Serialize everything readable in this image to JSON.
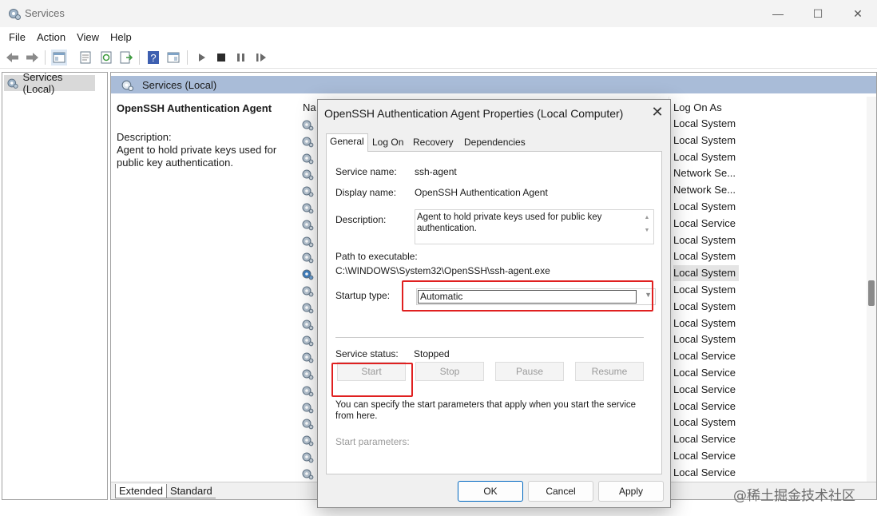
{
  "window": {
    "title": "Services",
    "minimize_glyph": "—",
    "maximize_glyph": "☐",
    "close_glyph": "✕"
  },
  "menu": [
    "File",
    "Action",
    "View",
    "Help"
  ],
  "toolbar_icons": [
    "back-arrow-icon",
    "forward-arrow-icon",
    "show-console-tree-icon",
    "properties-icon",
    "refresh-icon",
    "export-list-icon",
    "help-icon",
    "show-action-pane-icon",
    "start-service-icon",
    "stop-service-icon",
    "pause-service-icon",
    "resume-service-icon"
  ],
  "tree": {
    "selected_label": "Services (Local)"
  },
  "main": {
    "header": "Services (Local)",
    "service_name": "OpenSSH Authentication Agent",
    "description_label": "Description:",
    "description_text": "Agent to hold private keys used for public key authentication.",
    "column_name_partial": "Na",
    "column_logon": "Log On As",
    "logon_values": [
      "Local System",
      "Local System",
      "Local System",
      "Network Se...",
      "Network Se...",
      "Local System",
      "Local Service",
      "Local System",
      "Local System",
      "Local System",
      "Local System",
      "Local System",
      "Local System",
      "Local System",
      "Local Service",
      "Local Service",
      "Local Service",
      "Local Service",
      "Local System",
      "Local Service",
      "Local Service",
      "Local Service"
    ],
    "selected_row_index": 9,
    "bottom_tabs": [
      "Extended",
      "Standard"
    ]
  },
  "dialog": {
    "title": "OpenSSH Authentication Agent Properties (Local Computer)",
    "close_glyph": "✕",
    "tabs": [
      "General",
      "Log On",
      "Recovery",
      "Dependencies"
    ],
    "active_tab": "General",
    "service_name_label": "Service name:",
    "service_name_value": "ssh-agent",
    "display_name_label": "Display name:",
    "display_name_value": "OpenSSH Authentication Agent",
    "description_label": "Description:",
    "description_value": "Agent to hold private keys used for public key authentication.",
    "path_label": "Path to executable:",
    "path_value": "C:\\WINDOWS\\System32\\OpenSSH\\ssh-agent.exe",
    "startup_type_label": "Startup type:",
    "startup_type_value": "Automatic",
    "status_label": "Service status:",
    "status_value": "Stopped",
    "buttons": {
      "start": "Start",
      "stop": "Stop",
      "pause": "Pause",
      "resume": "Resume"
    },
    "hint": "You can specify the start parameters that apply when you start the service from here.",
    "start_params_label": "Start parameters:",
    "ok": "OK",
    "cancel": "Cancel",
    "apply": "Apply"
  },
  "watermark": "@稀土掘金技术社区",
  "colors": {
    "header_bar": "#a9bcd8",
    "highlight_red": "#e02020",
    "ok_border": "#0067c0"
  }
}
